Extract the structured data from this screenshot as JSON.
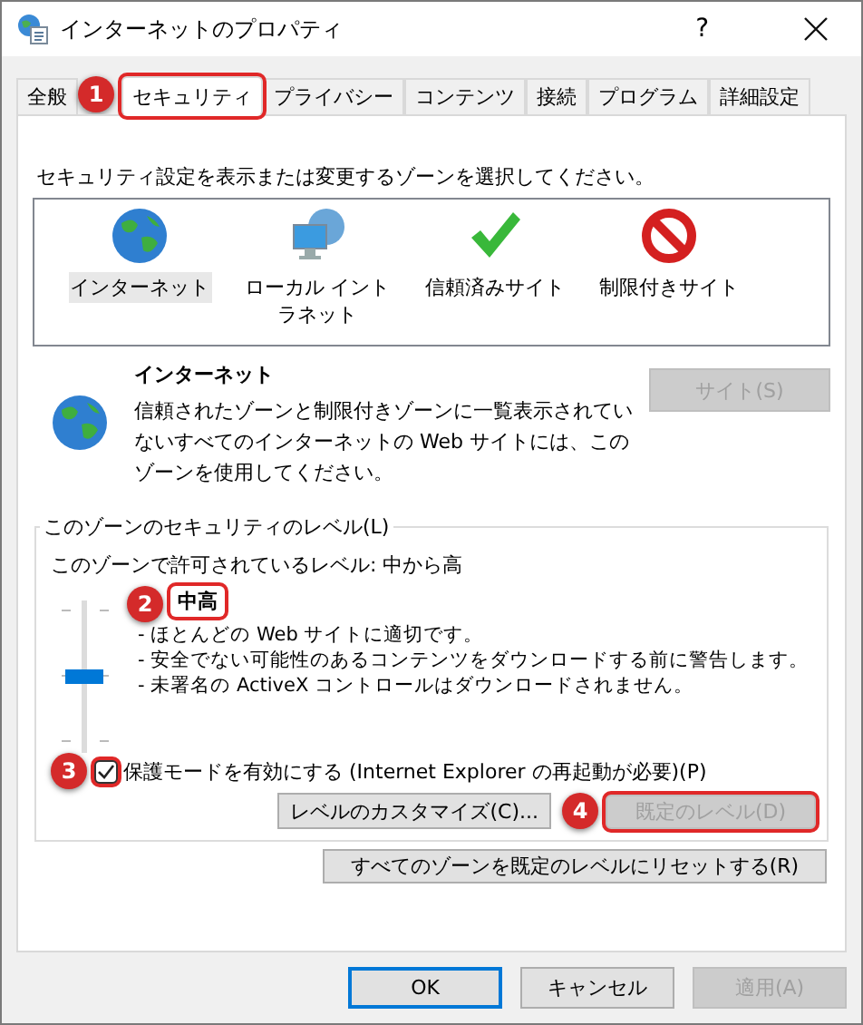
{
  "window": {
    "title": "インターネットのプロパティ",
    "help": "?"
  },
  "tabs": [
    {
      "label": "全般",
      "selected": false
    },
    {
      "label": "セキュリティ",
      "selected": true,
      "callout": "1"
    },
    {
      "label": "プライバシー",
      "selected": false
    },
    {
      "label": "コンテンツ",
      "selected": false
    },
    {
      "label": "接続",
      "selected": false
    },
    {
      "label": "プログラム",
      "selected": false
    },
    {
      "label": "詳細設定",
      "selected": false
    }
  ],
  "instruction": "セキュリティ設定を表示または変更するゾーンを選択してください。",
  "zones": [
    {
      "label": "インターネット",
      "kind": "globe",
      "selected": true
    },
    {
      "label": "ローカル イントラネット",
      "kind": "intranet",
      "selected": false
    },
    {
      "label": "信頼済みサイト",
      "kind": "trusted",
      "selected": false
    },
    {
      "label": "制限付きサイト",
      "kind": "restricted",
      "selected": false
    }
  ],
  "zone_detail": {
    "title": "インターネット",
    "description": "信頼されたゾーンと制限付きゾーンに一覧表示されていないすべてのインターネットの Web サイトには、このゾーンを使用してください。",
    "sites_button": {
      "label": "サイト(S)",
      "disabled": true
    }
  },
  "security_level": {
    "legend": "このゾーンのセキュリティのレベル(L)",
    "allowed": "このゾーンで許可されているレベル: 中から高",
    "level": 0.5,
    "level_name": "中高",
    "level_callout": "2",
    "bullets": [
      "- ほとんどの Web サイトに適切です。",
      "- 安全でない可能性のあるコンテンツをダウンロードする前に警告します。",
      "- 未署名の ActiveX コントロールはダウンロードされません。"
    ],
    "protected_mode": {
      "label": "保護モードを有効にする (Internet Explorer の再起動が必要)(P)",
      "checked": true,
      "callout": "3"
    },
    "custom_button": {
      "label": "レベルのカスタマイズ(C)...",
      "disabled": false
    },
    "default_button": {
      "label": "既定のレベル(D)",
      "disabled": true,
      "callout": "4"
    }
  },
  "reset_button": {
    "label": "すべてのゾーンを既定のレベルにリセットする(R)",
    "disabled": false
  },
  "dialog_buttons": [
    {
      "label": "OK",
      "disabled": false,
      "default": true
    },
    {
      "label": "キャンセル",
      "disabled": false,
      "default": false
    },
    {
      "label": "適用(A)",
      "disabled": true,
      "default": false
    }
  ]
}
